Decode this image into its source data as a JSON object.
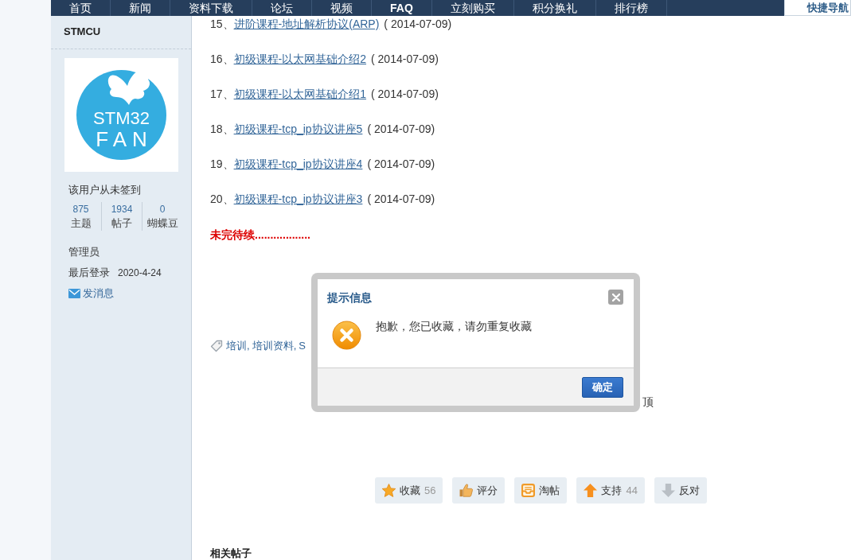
{
  "nav": {
    "items": [
      {
        "label": "首页"
      },
      {
        "label": "新闻"
      },
      {
        "label": "资料下载"
      },
      {
        "label": "论坛"
      },
      {
        "label": "视频"
      },
      {
        "label": "FAQ"
      },
      {
        "label": "立刻购买"
      },
      {
        "label": "积分换礼"
      },
      {
        "label": "排行榜"
      }
    ],
    "quick_nav": "快捷导航"
  },
  "sidebar": {
    "username": "STMCU",
    "avatar": {
      "logo_lines": [
        "STM32",
        "FAN"
      ]
    },
    "checkin": "该用户从未签到",
    "stats": [
      {
        "value": "875",
        "label": "主题"
      },
      {
        "value": "1934",
        "label": "帖子"
      },
      {
        "value": "0",
        "label": "蝴蝶豆"
      }
    ],
    "group": "管理员",
    "last_login": {
      "label": "最后登录",
      "value": "2020-4-24"
    },
    "message_link": "发消息"
  },
  "content": {
    "lessons": [
      {
        "number": "15、",
        "title": "进阶课程-地址解析协议(ARP)",
        "date": "( 2014-07-09)"
      },
      {
        "number": "16、",
        "title": "初级课程-以太网基础介绍2",
        "date": "( 2014-07-09)"
      },
      {
        "number": "17、",
        "title": "初级课程-以太网基础介绍1",
        "date": "( 2014-07-09)"
      },
      {
        "number": "18、",
        "title": "初级课程-tcp_ip协议讲座5",
        "date": "( 2014-07-09)"
      },
      {
        "number": "19、",
        "title": "初级课程-tcp_ip协议讲座4",
        "date": "( 2014-07-09)"
      },
      {
        "number": "20、",
        "title": "初级课程-tcp_ip协议讲座3",
        "date": "( 2014-07-09)"
      }
    ],
    "to_be_continued": "未完待续..................",
    "tags": [
      {
        "label": "培训",
        "suffix": ","
      },
      {
        "label": "培训资料",
        "suffix": ","
      },
      {
        "label": "S"
      }
    ],
    "thread_note": "顶"
  },
  "actions": [
    {
      "kind": "favorite",
      "label": "收藏",
      "count": "56"
    },
    {
      "kind": "rate",
      "label": "评分"
    },
    {
      "kind": "collect",
      "label": "淘帖"
    },
    {
      "kind": "support",
      "label": "支持",
      "count": "44"
    },
    {
      "kind": "oppose",
      "label": "反对"
    }
  ],
  "related": {
    "title": "相关帖子"
  },
  "dialog": {
    "title": "提示信息",
    "message": "抱歉，您已收藏，请勿重复收藏",
    "button": "确定"
  }
}
